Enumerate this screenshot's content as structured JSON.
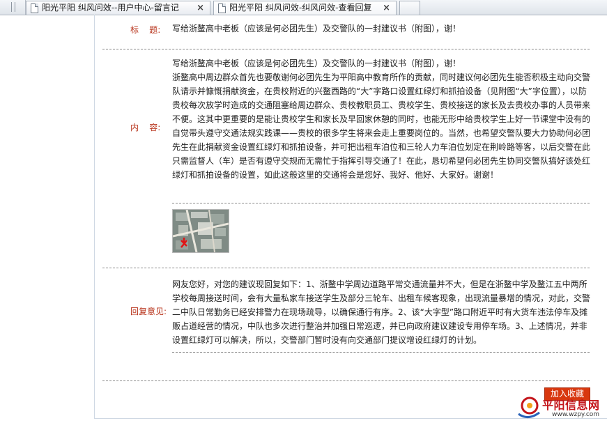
{
  "tabs": [
    {
      "title": "阳光平阳 纠风问效--用户中心-留言记",
      "close": "×"
    },
    {
      "title": "阳光平阳 纠风问效-纠风问效-查看回复",
      "close": "×"
    }
  ],
  "labels": {
    "title": "标    题:",
    "content": "内    容:",
    "reply": "回复意见:"
  },
  "letter": {
    "title": "写给浙鳌高中老板（应该是何必团先生）及交警队的一封建议书（附图），谢！",
    "content_heading": "写给浙鳌高中老板（应该是何必团先生）及交警队的一封建议书（附图），谢！",
    "content_body": "浙鳌高中周边群众首先也要敬谢何必团先生为平阳高中教育所作的贡献，同时建议何必团先生能否积极主动向交警队请示并慷慨捐献资金，在贵校附近的兴鳌西路的“大”字路口设置红绿灯和抓拍设备（见附图“大”字位置），以防贵校每次放学时造成的交通阻塞给周边群众、贵校教职员工、贵校学生、贵校接送的家长及去贵校办事的人员带来不便。这其中更重要的是能让贵校学生和家长及早回家休憩的同时，也能无形中给贵校学生上好一节课堂中没有的自觉带头遵守交通法规实践课——贵校的很多学生将来会走上重要岗位的。当然，也希望交警队要大力协助何必团先生在此捐献资金设置红绿灯和抓拍设备，并可把出租车泊位和三轮人力车泊位划定在荆岭路等客，以后交警在此只需监督人（车）是否有遵守交规而无需忙于指挥引导交通了！在此，恳切希望何必团先生协同交警队搞好该处红绿灯和抓拍设备的设置，如此这般这里的交通将会是您好、我好、他好、大家好。谢谢！",
    "reply": "网友您好，对您的建议现回复如下：1、浙鳌中学周边道路平常交通流量并不大，但是在浙鳌中学及鳌江五中两所学校每周接送时间，会有大量私家车接送学生及部分三轮车、出租车候客现象，出现流量暴增的情况，对此，交警二中队日常勤务已经安排警力在现场疏导，以确保通行有序。2、该“大字型”路口附近平时有大货车违法停车及摊贩占道经营的情况，中队也多次进行整治并加强日常巡逻，并已向政府建议建设专用停车场。3、上述情况，并非设置红绿灯可以解决，所以，交警部门暂时没有向交通部门提议增设红绿灯的计划。"
  },
  "buttons": {
    "favorite": "加入收藏"
  },
  "logo": {
    "name": "平阳信息网",
    "url": "www.wzpy.com"
  },
  "colors": {
    "label": "#b8341c",
    "favorite_button": "#d8380f",
    "logo": "#c4161c"
  }
}
